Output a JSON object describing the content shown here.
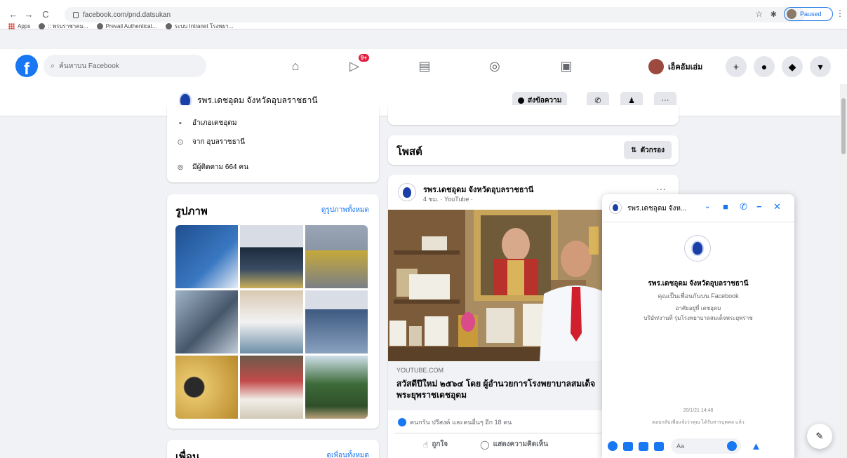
{
  "browser": {
    "url": "facebook.com/pnd.datsukan",
    "bookmarks": [
      "Apps",
      ":: พรบราชาคม...",
      "Prevail Authenticat...",
      "ระบบ Intranet โรงพยา..."
    ],
    "profile_label": "Paused"
  },
  "fb_nav": {
    "logo": "f",
    "search_placeholder": "ค้นหาบน Facebook",
    "video_badge": "9+",
    "user_name": "เอ็คอัมเอ่ม"
  },
  "page_header": {
    "name": "รพร.เดชอุดม จังหวัดอุบลราชธานี",
    "message_label": "ส่งข้อความ"
  },
  "intro": {
    "items": [
      {
        "icon": "briefcase-icon",
        "text": "อำเภอเดชอุดม"
      },
      {
        "icon": "location-pin-icon",
        "text": "จาก อุบลราชธานี"
      },
      {
        "icon": "followers-icon",
        "text": "มีผู้ติดตาม 664 คน"
      }
    ]
  },
  "photos": {
    "title": "รูปภาพ",
    "link": "ดูรูปภาพทั้งหมด"
  },
  "friends": {
    "title": "เพื่อน",
    "link": "ดูเพื่อนทั้งหมด"
  },
  "posts": {
    "title": "โพสต์",
    "filter_label": "ตัวกรอง"
  },
  "post": {
    "author": "รพร.เดชอุดม จังหวัดอุบลราชธานี",
    "meta": "4 ชม. · YouTube ·",
    "link_domain": "YOUTUBE.COM",
    "link_title": "สวัสดีปีใหม่ ๒๕๖๔ โดย ผู้อำนวยการโรงพยาบาลสมเด็จพระยุพราชเดชอุดม",
    "reactions": "คนกรัน ปรีสงค์ และคนอื่นๆ อีก 18 คน",
    "like_label": "ถูกใจ",
    "comment_label": "แสดงความคิดเห็น"
  },
  "chat": {
    "name": "รพร.เดชอุดม จังห...",
    "title": "รพร.เดชอุดม จังหวัดอุบลราชธานี",
    "subtitle": "คุณเป็นเพื่อนกันบน Facebook",
    "line3": "อาศัยอยู่ที่ เดชอุดม",
    "line4": "บริษัท/งานที่ รุ่มโรงพยาบาลสมเด็จพระยุพราช",
    "timestamp": "20/1/21 14:48",
    "footer_note": "ตอบกลับเพื่อแจ้งว่าคุณ ได้รับสารบุคคล แล้ว",
    "input_placeholder": "Aa"
  }
}
